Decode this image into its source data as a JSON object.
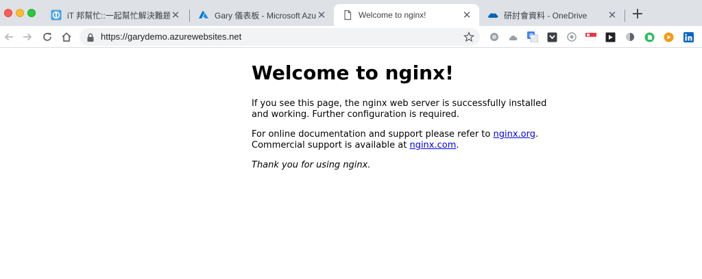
{
  "window": {
    "buttons": [
      "close",
      "minimize",
      "zoom"
    ]
  },
  "tabs": [
    {
      "title": "iT 邦幫忙::一起幫忙解決難題，拯",
      "icon": "ithome-icon",
      "active": false
    },
    {
      "title": "Gary 儀表板 - Microsoft Azure",
      "icon": "azure-icon",
      "active": false
    },
    {
      "title": "Welcome to nginx!",
      "icon": "page-icon",
      "active": true
    },
    {
      "title": "研討會資料 - OneDrive",
      "icon": "onedrive-icon",
      "active": false
    }
  ],
  "tab_close_glyph": "✕",
  "new_tab_glyph": "+",
  "address_bar": {
    "url": "https://garydemo.azurewebsites.net",
    "secure_icon": "lock-icon"
  },
  "extensions": [
    "grey-circle-extension-icon",
    "cloud-extension-icon",
    "google-translate-icon",
    "pocket-extension-icon",
    "eye-extension-icon",
    "singapore-flag-icon",
    "media-extension-icon",
    "dark-extension-icon",
    "evernote-icon",
    "orange-play-icon",
    "linkedin-icon"
  ],
  "page": {
    "heading": "Welcome to nginx!",
    "para1": "If you see this page, the nginx web server is successfully installed and working. Further configuration is required.",
    "para2_prefix": "For online documentation and support please refer to ",
    "link1": "nginx.org",
    "para2_mid": ".",
    "para2_line2": "Commercial support is available at ",
    "link2": "nginx.com",
    "para2_end": ".",
    "thanks": "Thank you for using nginx."
  },
  "colors": {
    "tab_strip": "#dee1e6",
    "link": "#0000ee",
    "omnibox": "#f1f3f4"
  }
}
